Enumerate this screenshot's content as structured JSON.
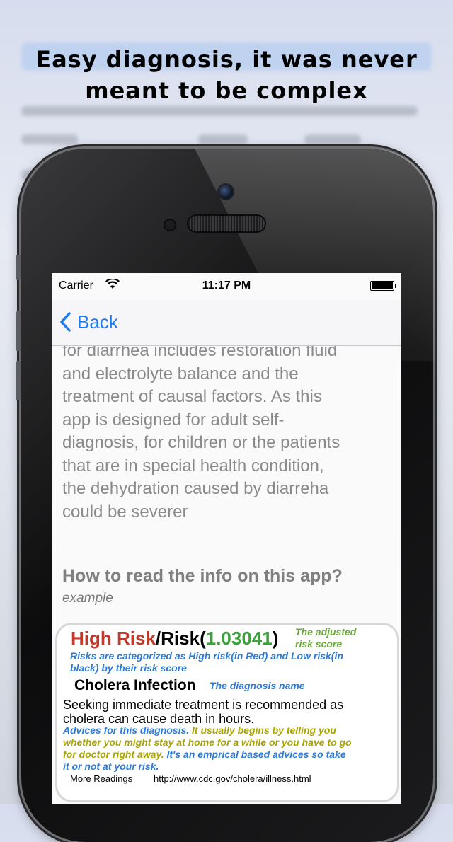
{
  "headline": {
    "line1": "Easy diagnosis, it was never",
    "line2": "meant to be complex"
  },
  "status_bar": {
    "carrier": "Carrier",
    "time": "11:17 PM"
  },
  "nav": {
    "back_label": "Back"
  },
  "body_text": [
    "for diarrhea includes restoration fluid",
    "and electrolyte balance and the",
    "treatment of causal factors. As this",
    "app is designed for adult self-",
    "diagnosis, for children or the patients",
    "that are in special health condition,",
    "the dehydration caused by diarreha",
    "could be severer"
  ],
  "section": {
    "title": "How to read the info on this app?",
    "subtitle": "example"
  },
  "example_card": {
    "risk_high": "High Risk",
    "risk_sep": "/Risk(",
    "risk_value": "1.03041",
    "risk_close": ")",
    "adjusted_note_1": "The adjusted",
    "adjusted_note_2": "risk score",
    "category_note_1": "Risks are categorized as High risk(in Red) and Low risk(in",
    "category_note_2": "black) by their risk score",
    "diagnosis_name": "Cholera Infection",
    "diagnosis_note": "The diagnosis name",
    "advice_1": "Seeking immediate treatment is recommended as",
    "advice_2": "cholera can cause death in hours.",
    "advice_note_1a": "Advices for this diagnosis.",
    "advice_note_1b": " It usually begins by telling you",
    "advice_note_2": "whether you might stay at home for a while or you have to go",
    "advice_note_3a": "for doctor right away.",
    "advice_note_3b": " It's an emprical based advices so take",
    "advice_note_4": "it or not at your risk.",
    "more_label": "More Readings",
    "more_url": "http://www.cdc.gov/cholera/illness.html"
  },
  "colors": {
    "accent_blue": "#1f7bf0",
    "risk_red": "#c0392b",
    "risk_green": "#3ba33b",
    "note_blue": "#2c7bd8",
    "note_olive": "#a8a400"
  }
}
